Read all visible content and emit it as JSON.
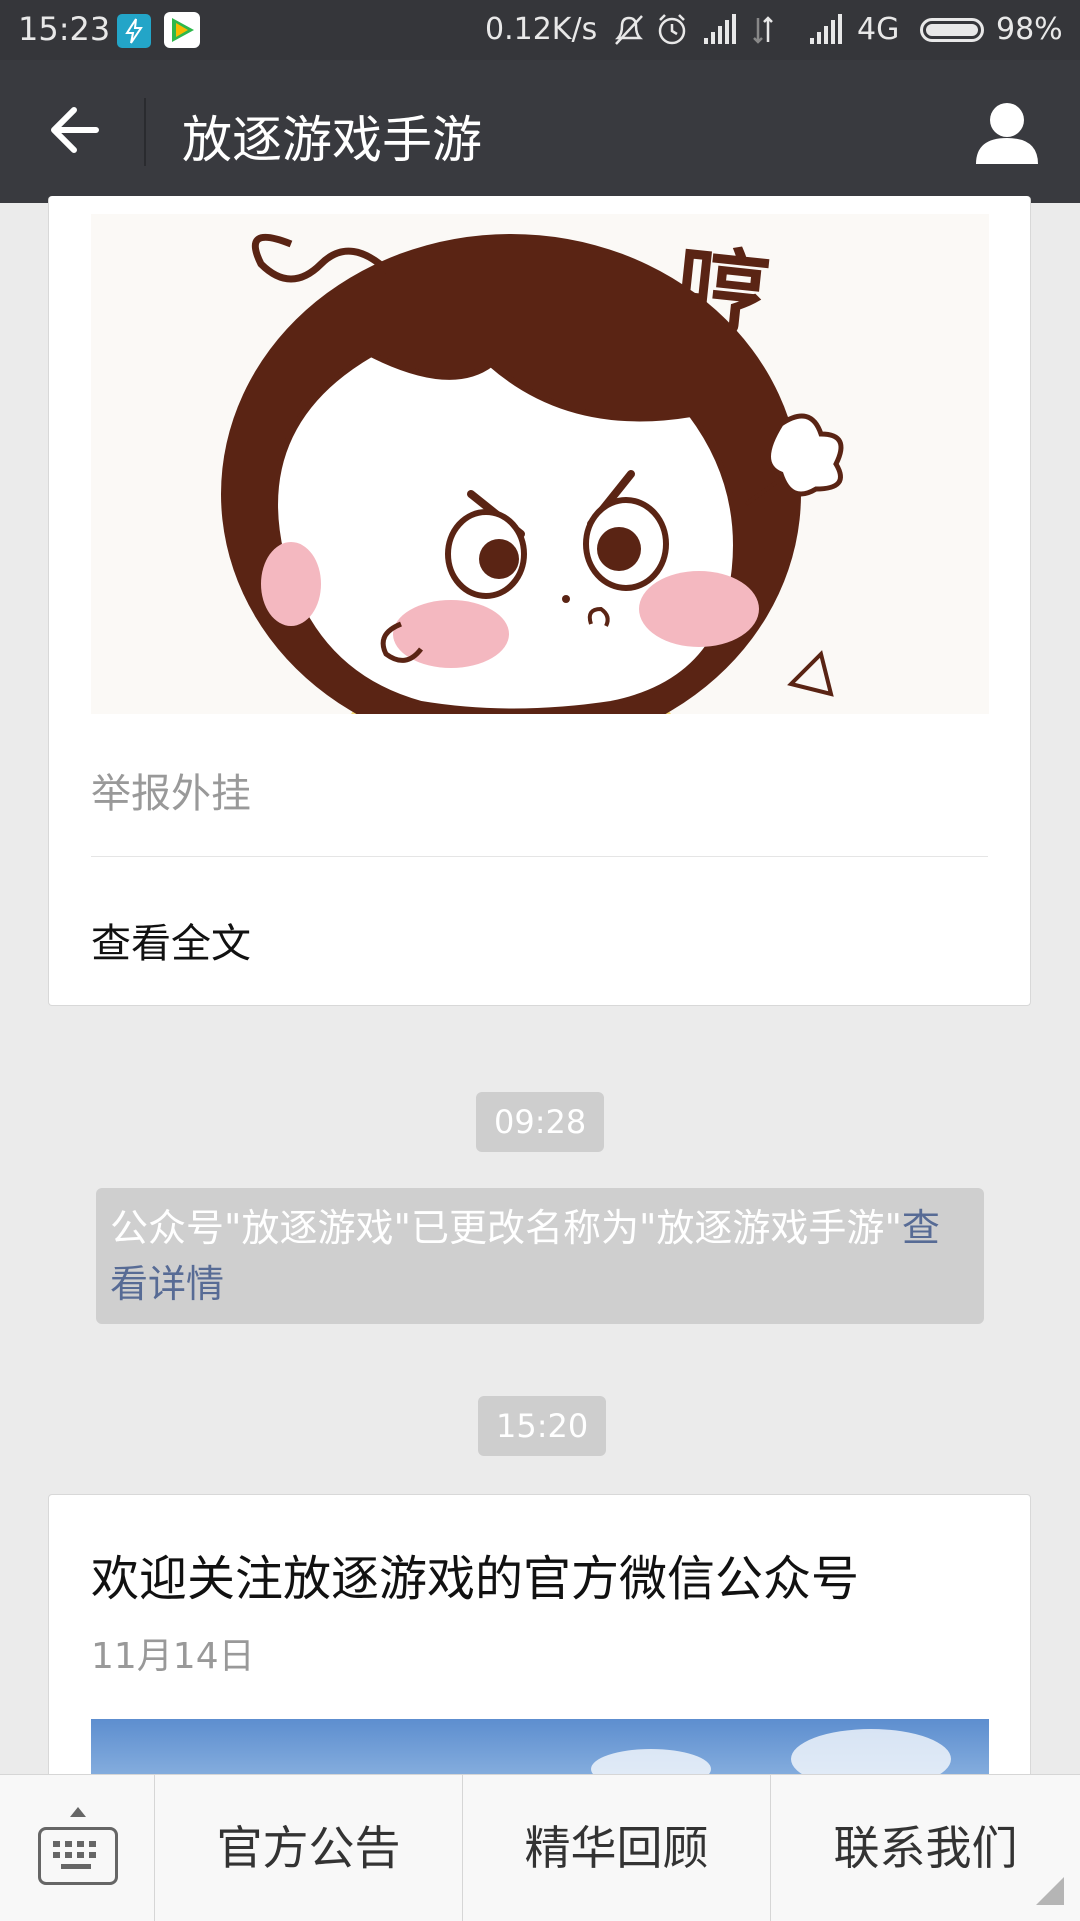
{
  "status_bar": {
    "time": "15:23",
    "net_speed": "0.12K/s",
    "network": "4G",
    "battery": "98%",
    "icons": [
      "lightning-app-icon",
      "video-app-icon",
      "mute-bell-icon",
      "alarm-icon",
      "signal-icon",
      "data-arrows-icon",
      "signal-icon",
      "battery-icon"
    ]
  },
  "header": {
    "title": "放逐游戏手游",
    "back_icon": "back-arrow-icon",
    "profile_icon": "person-icon"
  },
  "chat": {
    "article_card": {
      "image": "angry-cartoon-girl-illustration",
      "image_caption_text": "哼",
      "description": "举报外挂",
      "read_all_label": "查看全文"
    },
    "timestamp_1": "09:28",
    "system_message": {
      "text": "公众号\"放逐游戏\"已更改名称为\"放逐游戏手游\"",
      "link": "查看详情"
    },
    "timestamp_2": "15:20",
    "welcome_card": {
      "title": "欢迎关注放逐游戏的官方微信公众号",
      "date": "11月14日",
      "cover_image": "sky-clouds-cover"
    }
  },
  "menu": {
    "keyboard_icon": "keyboard-icon",
    "items": [
      "官方公告",
      "精华回顾",
      "联系我们"
    ]
  },
  "colors": {
    "title_bar": "#393a3f",
    "status_bar": "#35363a",
    "chat_background": "#ebebeb",
    "link": "#576b95",
    "hair": "#5a2414",
    "blush": "#f4b8c0"
  }
}
